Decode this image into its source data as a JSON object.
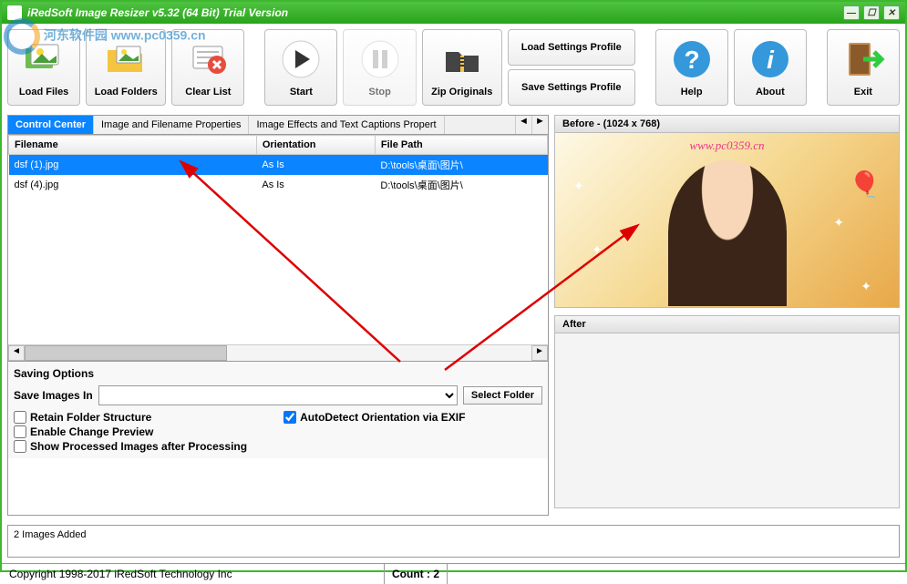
{
  "title": "iRedSoft Image Resizer v5.32 (64 Bit) Trial Version",
  "toolbar": {
    "load_files": "Load Files",
    "load_folders": "Load Folders",
    "clear_list": "Clear List",
    "start": "Start",
    "stop": "Stop",
    "zip_originals": "Zip Originals",
    "load_settings": "Load Settings Profile",
    "save_settings": "Save Settings Profile",
    "help": "Help",
    "about": "About",
    "exit": "Exit"
  },
  "tabs": {
    "control_center": "Control Center",
    "image_props": "Image and Filename Properties",
    "effects": "Image Effects and Text Captions Propert"
  },
  "table": {
    "headers": {
      "filename": "Filename",
      "orientation": "Orientation",
      "filepath": "File Path"
    },
    "rows": [
      {
        "filename": "dsf (1).jpg",
        "orientation": "As Is",
        "filepath": "D:\\tools\\桌面\\图片\\"
      },
      {
        "filename": "dsf (4).jpg",
        "orientation": "As Is",
        "filepath": "D:\\tools\\桌面\\图片\\"
      }
    ]
  },
  "saving": {
    "title": "Saving Options",
    "save_images_in": "Save Images In",
    "select_folder": "Select Folder",
    "retain_folder": "Retain Folder Structure",
    "enable_preview": "Enable Change Preview",
    "show_processed": "Show Processed Images after Processing",
    "autodetect": "AutoDetect Orientation via EXIF"
  },
  "status": "2 Images Added",
  "footer": {
    "copyright": "Copyright 1998-2017 iRedSoft Technology Inc",
    "count": "Count : 2"
  },
  "preview": {
    "before": "Before - (1024 x 768)",
    "after": "After",
    "watermark": "www.pc0359.cn"
  },
  "overlay_watermark": "河东软件园  www.pc0359.cn"
}
